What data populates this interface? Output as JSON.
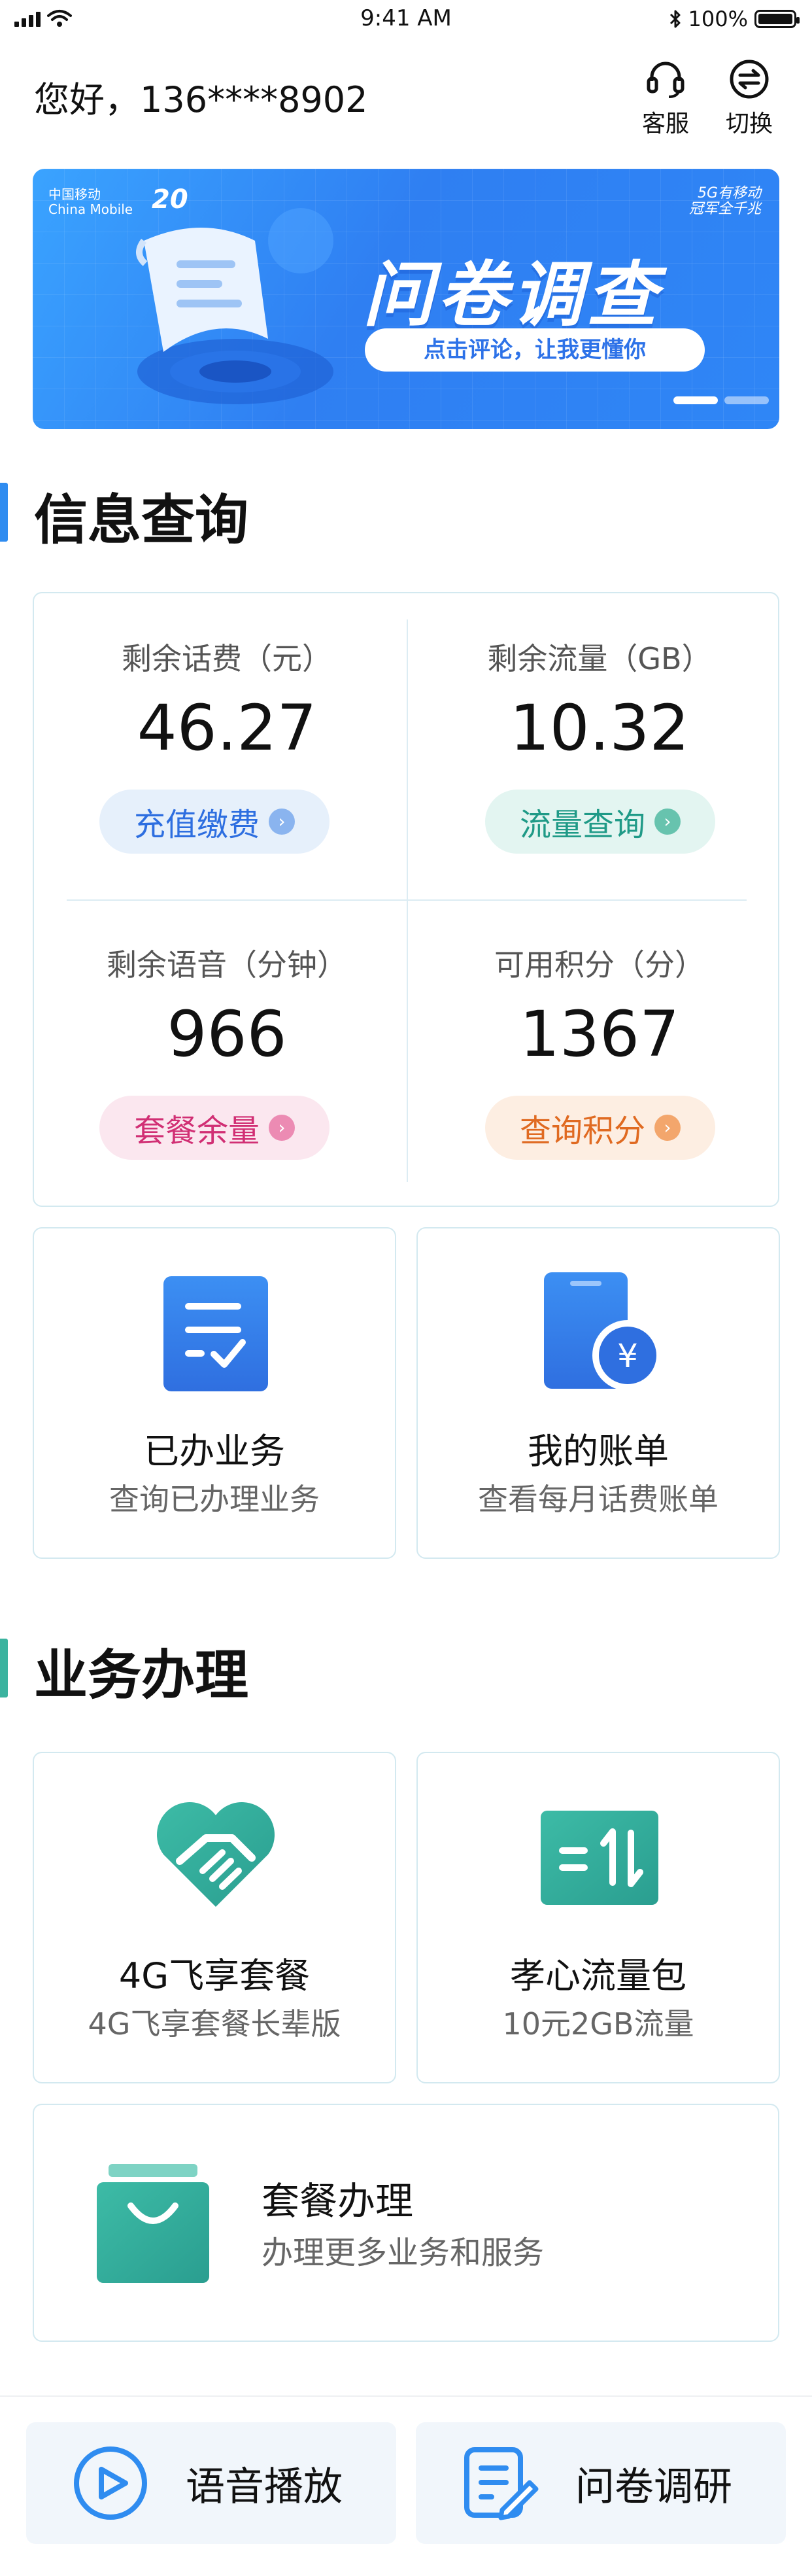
{
  "status_bar": {
    "time": "9:41 AM",
    "battery": "100%"
  },
  "header": {
    "greeting": "您好，136****8902",
    "service_label": "客服",
    "switch_label": "切换"
  },
  "banner": {
    "brand_cn": "中国移动",
    "brand_en": "China Mobile",
    "brand_right_line1": "5G有移动",
    "brand_right_line2": "冠军全千兆",
    "anniversary": "20",
    "title": "问卷调查",
    "subtitle": "点击评论，让我更懂你"
  },
  "info_section": {
    "title": "信息查询",
    "accent": "#2f8cf0",
    "items": [
      {
        "label": "剩余话费（元）",
        "value": "46.27",
        "action": "充值缴费",
        "color": "#2d6ee0",
        "bg": "#e6f0fb",
        "arrow": "#8ab4ef"
      },
      {
        "label": "剩余流量（GB）",
        "value": "10.32",
        "action": "流量查询",
        "color": "#1f9a87",
        "bg": "#e3f5f1",
        "arrow": "#67c3ae"
      },
      {
        "label": "剩余语音（分钟）",
        "value": "966",
        "action": "套餐余量",
        "color": "#d12f74",
        "bg": "#fbe7ef",
        "arrow": "#ec8bb3"
      },
      {
        "label": "可用积分（分）",
        "value": "1367",
        "action": "查询积分",
        "color": "#e06a21",
        "bg": "#fdeee2",
        "arrow": "#f3a66c"
      }
    ]
  },
  "quick_tiles": [
    {
      "title": "已办业务",
      "subtitle": "查询已办理业务"
    },
    {
      "title": "我的账单",
      "subtitle": "查看每月话费账单"
    }
  ],
  "business_section": {
    "title": "业务办理",
    "accent": "#3bb39f",
    "tiles": [
      {
        "title": "4G飞享套餐",
        "subtitle": "4G飞享套餐长辈版"
      },
      {
        "title": "孝心流量包",
        "subtitle": "10元2GB流量"
      }
    ],
    "wide_tile": {
      "title": "套餐办理",
      "subtitle": "办理更多业务和服务"
    }
  },
  "bottom_bar": {
    "voice_label": "语音播放",
    "survey_label": "问卷调研"
  }
}
